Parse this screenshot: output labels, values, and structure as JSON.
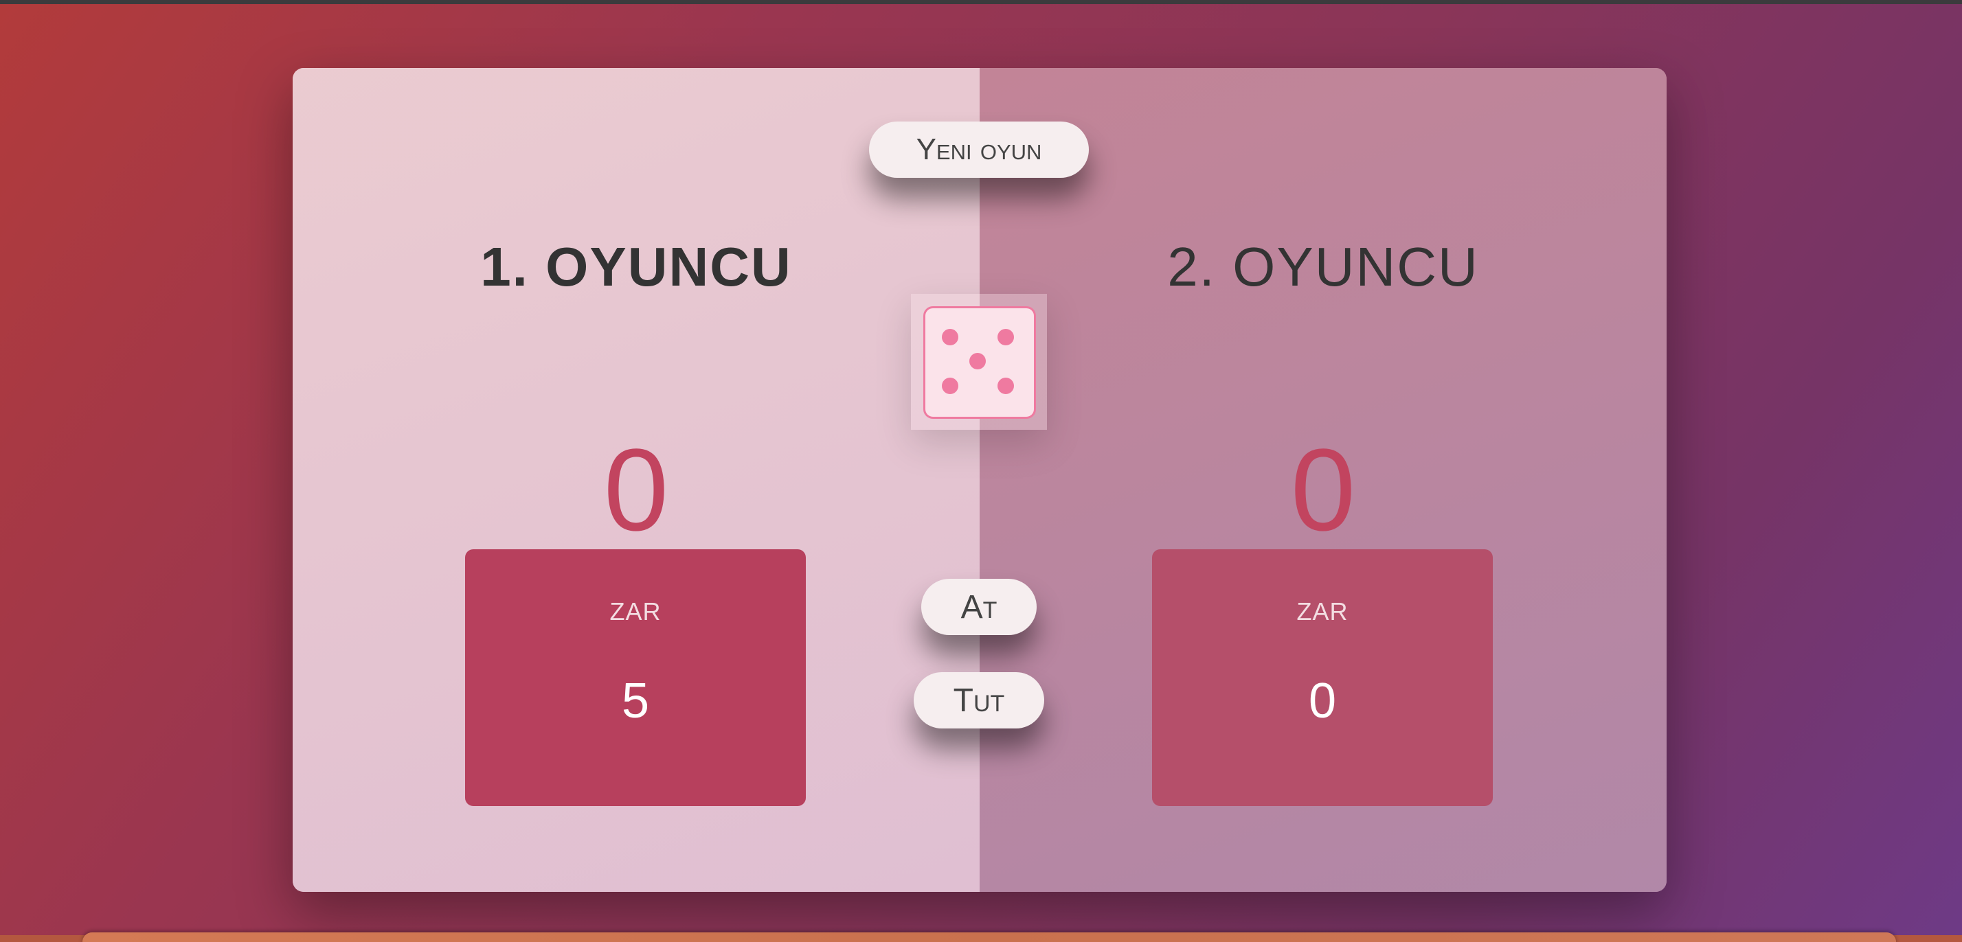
{
  "buttons": {
    "new_game": "Yeni oyun",
    "roll": "At",
    "hold": "Tut"
  },
  "players": [
    {
      "name": "1. OYUNCU",
      "score": "0",
      "current_label": "ZAR",
      "current_value": "5",
      "active": true
    },
    {
      "name": "2. OYUNCU",
      "score": "0",
      "current_label": "ZAR",
      "current_value": "0",
      "active": false
    }
  ],
  "dice": {
    "value": 5,
    "icon": "dice-five-icon"
  },
  "colors": {
    "accent": "#c2445f",
    "current_box": "#b7405d",
    "dice_pip": "#ef7aa0",
    "dice_face": "#fbe3ea"
  }
}
